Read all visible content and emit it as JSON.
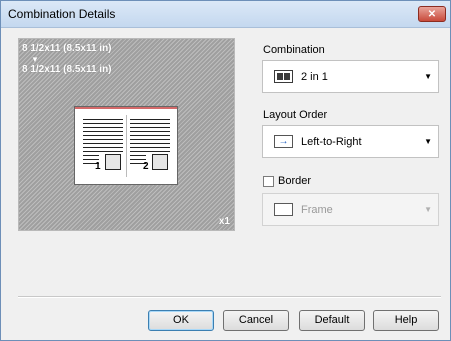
{
  "window": {
    "title": "Combination Details",
    "close_glyph": "✕"
  },
  "preview": {
    "paper_line1": "8 1/2x11 (8.5x11 in)",
    "arrow": "▼",
    "paper_line2": "8 1/2x11 (8.5x11 in)",
    "scale": "x1",
    "page_numbers": [
      "1",
      "2"
    ]
  },
  "combination": {
    "label": "Combination",
    "value": "2 in 1",
    "icon": "two-up-icon"
  },
  "layout_order": {
    "label": "Layout Order",
    "value": "Left-to-Right",
    "icon": "left-to-right-arrow-icon",
    "arrow_glyph": "→"
  },
  "border": {
    "label": "Border",
    "checked": false,
    "value": "Frame",
    "icon": "frame-icon"
  },
  "caret_glyph": "▼",
  "buttons": {
    "ok": "OK",
    "cancel": "Cancel",
    "default": "Default",
    "help": "Help"
  },
  "colors": {
    "title_bar": "#c4d8ef",
    "preview_bg": "#a9a9a9",
    "accent_blue": "#1f5fbf"
  }
}
